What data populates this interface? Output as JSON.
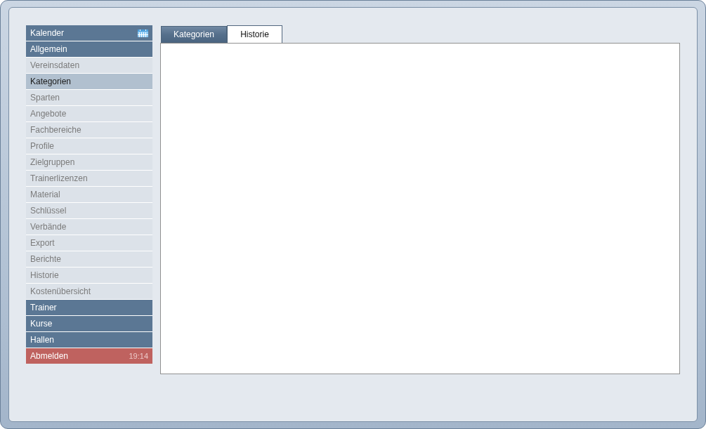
{
  "sidebar": {
    "items": [
      {
        "kind": "calendar",
        "label": "Kalender",
        "selected": false
      },
      {
        "kind": "section",
        "label": "Allgemein",
        "selected": false
      },
      {
        "kind": "entry",
        "label": "Vereinsdaten",
        "selected": false
      },
      {
        "kind": "entry",
        "label": "Kategorien",
        "selected": true
      },
      {
        "kind": "entry",
        "label": "Sparten",
        "selected": false
      },
      {
        "kind": "entry",
        "label": "Angebote",
        "selected": false
      },
      {
        "kind": "entry",
        "label": "Fachbereiche",
        "selected": false
      },
      {
        "kind": "entry",
        "label": "Profile",
        "selected": false
      },
      {
        "kind": "entry",
        "label": "Zielgruppen",
        "selected": false
      },
      {
        "kind": "entry",
        "label": "Trainerlizenzen",
        "selected": false
      },
      {
        "kind": "entry",
        "label": "Material",
        "selected": false
      },
      {
        "kind": "entry",
        "label": "Schlüssel",
        "selected": false
      },
      {
        "kind": "entry",
        "label": "Verbände",
        "selected": false
      },
      {
        "kind": "entry",
        "label": "Export",
        "selected": false
      },
      {
        "kind": "entry",
        "label": "Berichte",
        "selected": false
      },
      {
        "kind": "entry",
        "label": "Historie",
        "selected": false
      },
      {
        "kind": "entry",
        "label": "Kostenübersicht",
        "selected": false
      },
      {
        "kind": "section",
        "label": "Trainer",
        "selected": false
      },
      {
        "kind": "section",
        "label": "Kurse",
        "selected": false
      },
      {
        "kind": "section",
        "label": "Hallen",
        "selected": false
      },
      {
        "kind": "logout",
        "label": "Abmelden",
        "time": "19:14",
        "selected": false
      }
    ]
  },
  "tabs": [
    {
      "label": "Kategorien",
      "selected": false
    },
    {
      "label": "Historie",
      "selected": true
    }
  ]
}
